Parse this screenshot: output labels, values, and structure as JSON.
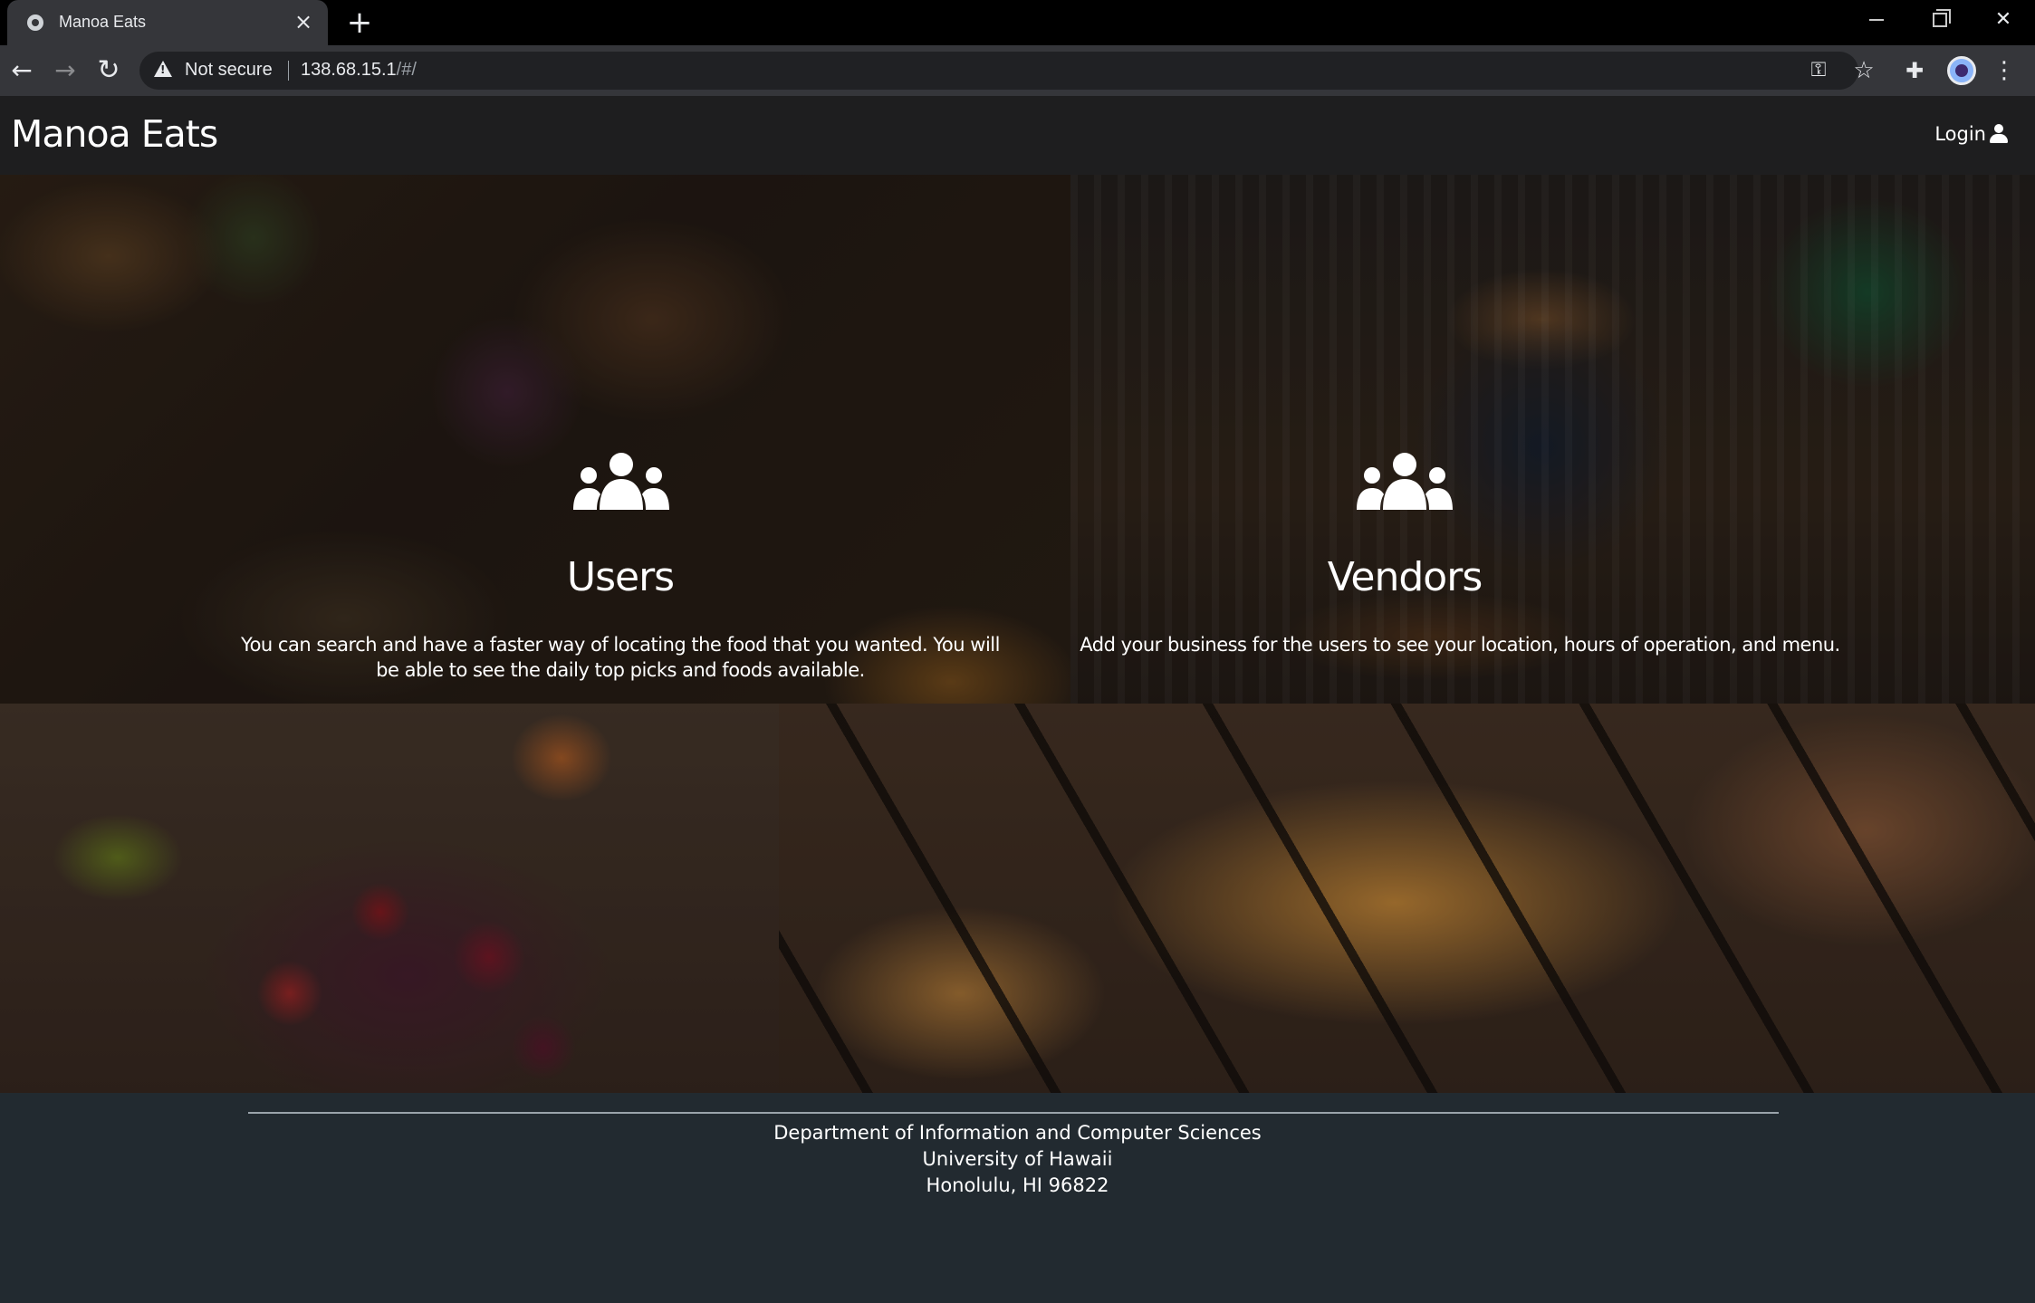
{
  "browser": {
    "tab_title": "Manoa Eats",
    "security_label": "Not secure",
    "url_host": "138.68.15.1",
    "url_path": "/#/"
  },
  "navbar": {
    "brand": "Manoa Eats",
    "login_label": "Login"
  },
  "hero": {
    "users": {
      "title": "Users",
      "description": "You can search and have a faster way of locating the food that you wanted. You will be able to see the daily top picks and foods available."
    },
    "vendors": {
      "title": "Vendors",
      "description": "Add your business for the users to see your location, hours of operation, and menu."
    }
  },
  "footer": {
    "line1": "Department of Information and Computer Sciences",
    "line2": "University of Hawaii",
    "line3": "Honolulu, HI 96822"
  },
  "colors": {
    "navbar_bg": "#1e1e1f",
    "footer_bg": "#222a30",
    "text": "#ffffff"
  }
}
